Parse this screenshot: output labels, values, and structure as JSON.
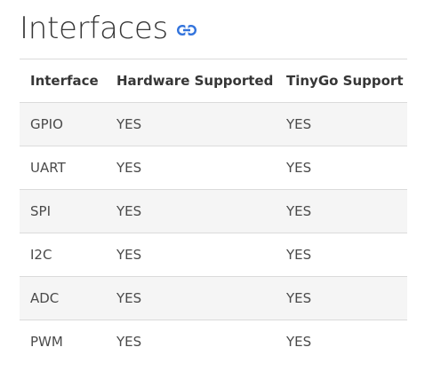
{
  "heading": {
    "title": "Interfaces",
    "anchor_icon": "link-icon"
  },
  "table": {
    "columns": [
      "Interface",
      "Hardware Supported",
      "TinyGo Support"
    ],
    "rows": [
      [
        "GPIO",
        "YES",
        "YES"
      ],
      [
        "UART",
        "YES",
        "YES"
      ],
      [
        "SPI",
        "YES",
        "YES"
      ],
      [
        "I2C",
        "YES",
        "YES"
      ],
      [
        "ADC",
        "YES",
        "YES"
      ],
      [
        "PWM",
        "YES",
        "YES"
      ]
    ]
  },
  "colors": {
    "link": "#3273dc",
    "stripe": "#f5f5f5",
    "border": "#dbdbdb"
  }
}
